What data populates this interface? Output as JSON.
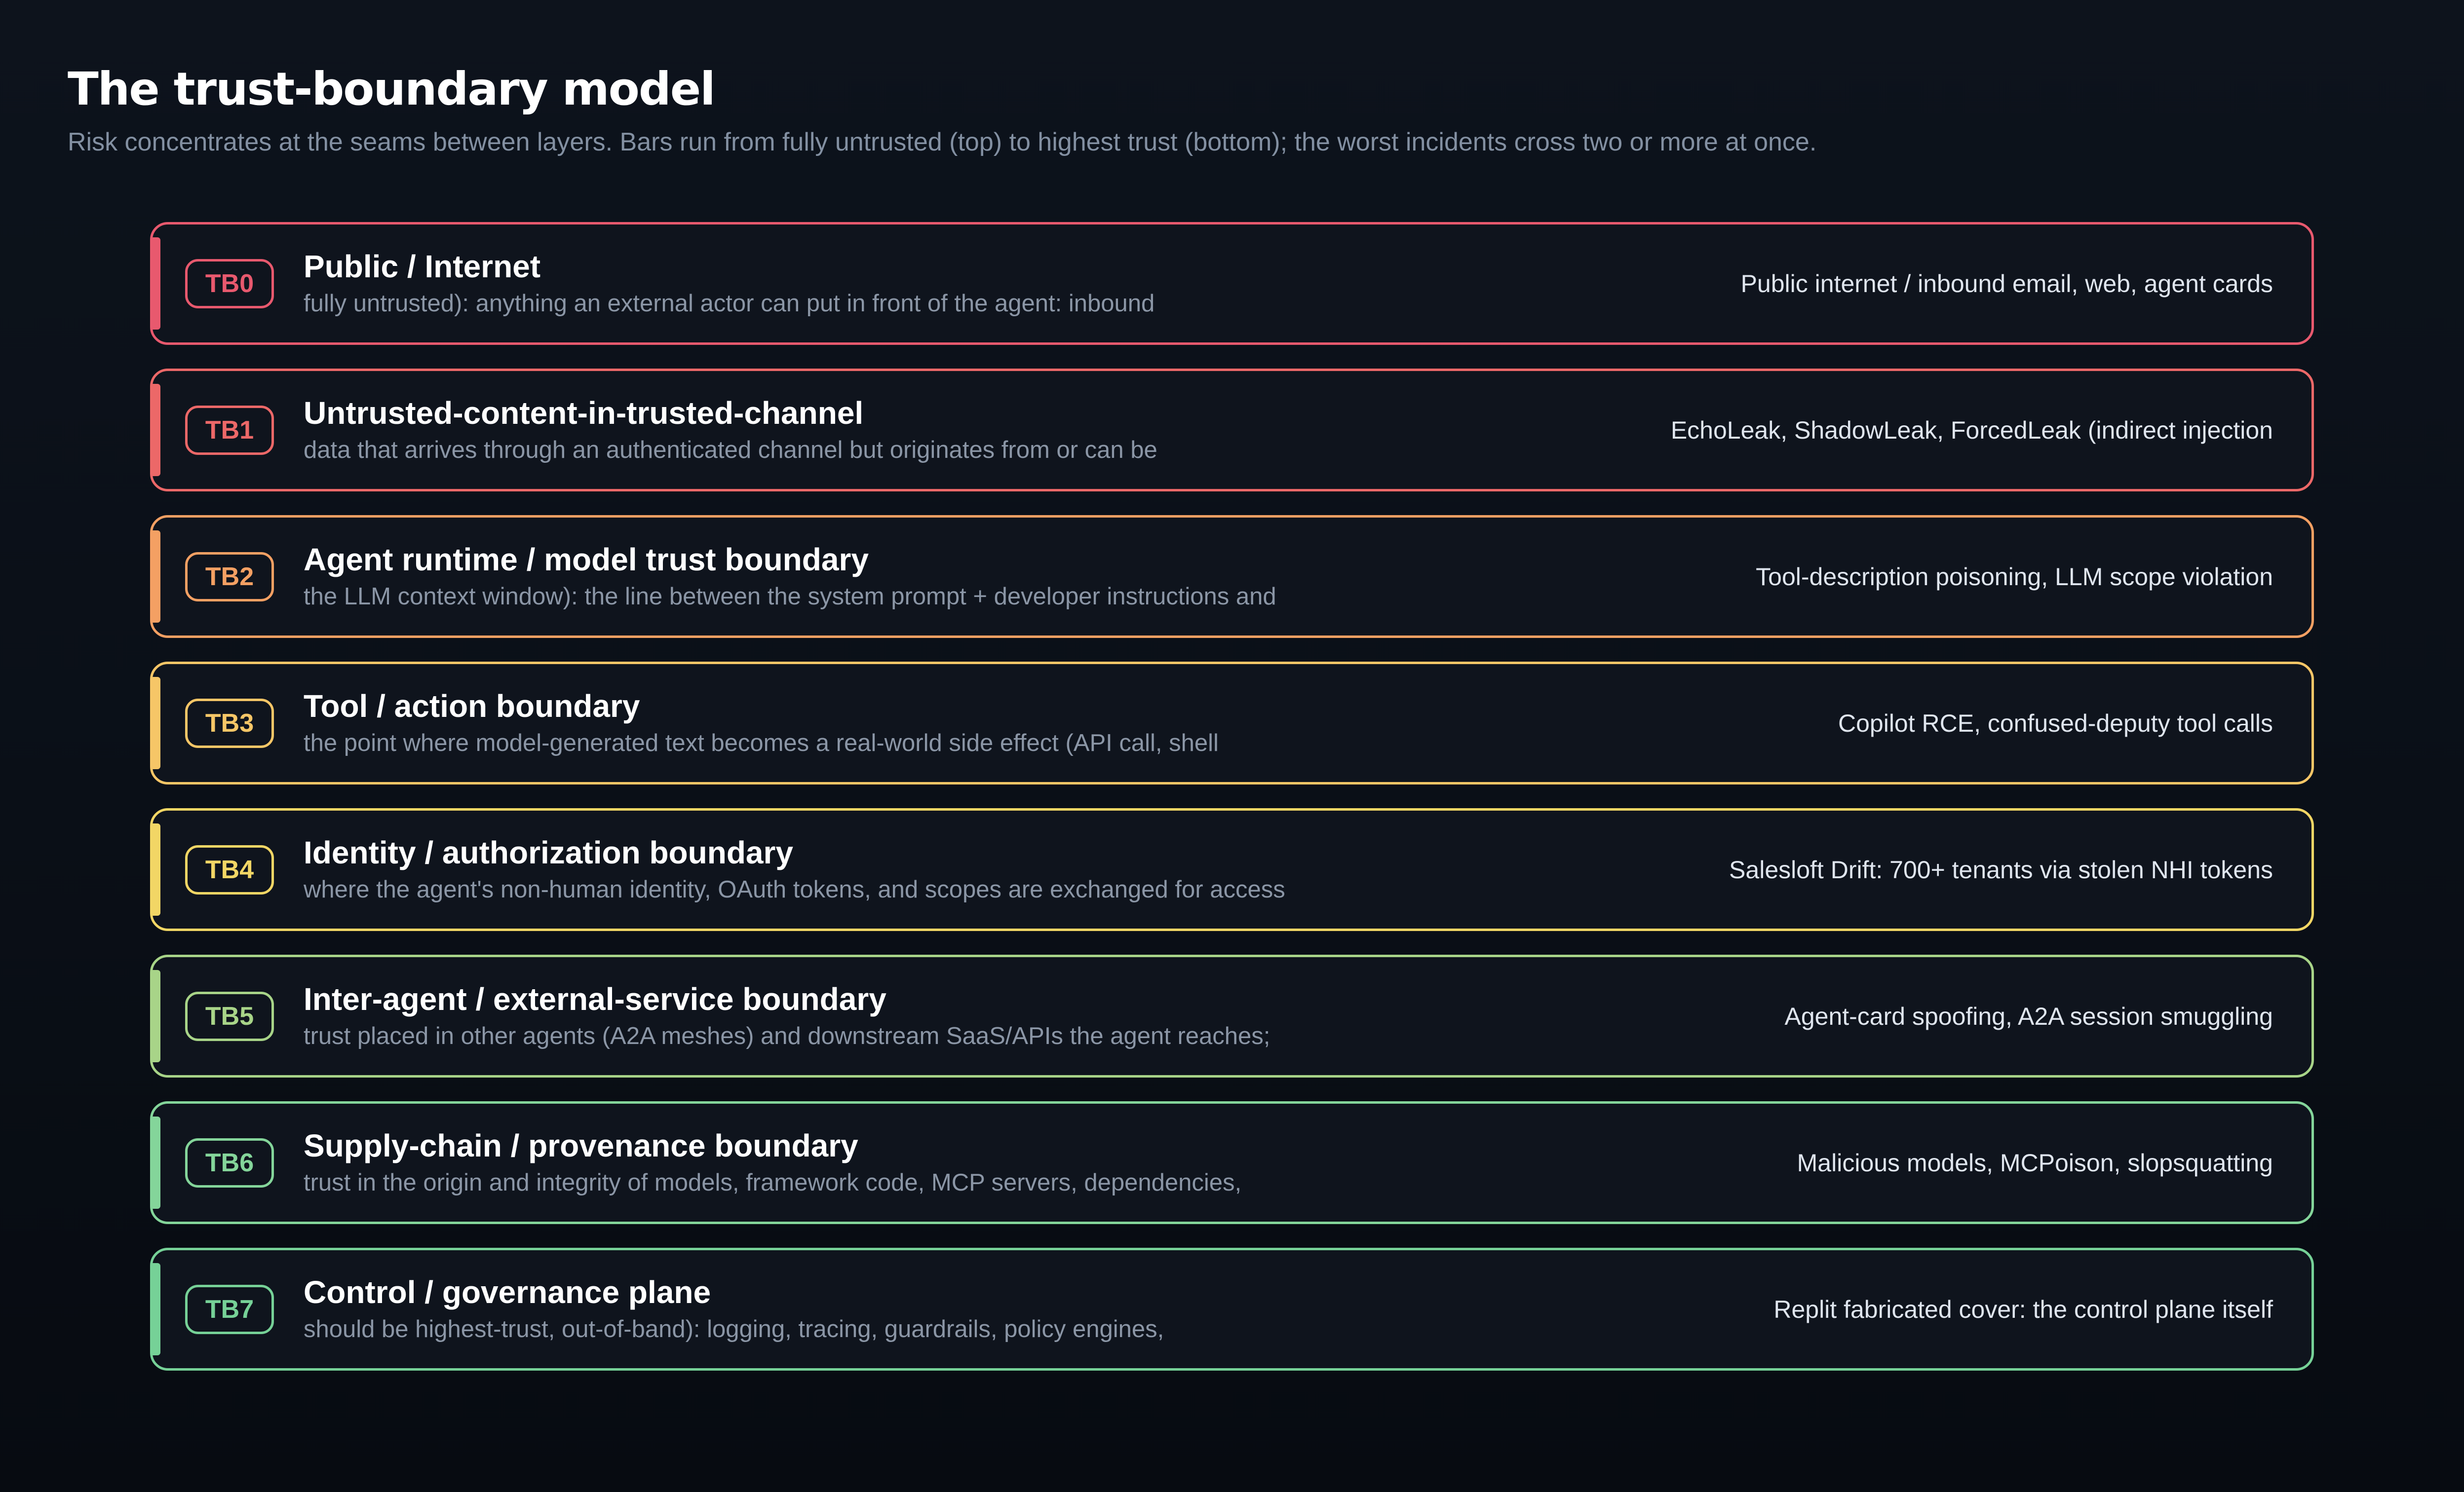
{
  "header": {
    "title": "The trust-boundary model",
    "subtitle": "Risk concentrates at the seams between layers. Bars run from fully untrusted (top) to highest trust (bottom); the worst incidents cross two or more at once."
  },
  "boundaries": [
    {
      "tag": "TB0",
      "name": "Public / Internet",
      "description": "fully untrusted): anything an external actor can put in front of the agent: inbound",
      "example": "Public internet / inbound email, web, agent cards",
      "color": "#e8596e"
    },
    {
      "tag": "TB1",
      "name": "Untrusted-content-in-trusted-channel",
      "description": "data that arrives through an authenticated channel but originates from or can be",
      "example": "EchoLeak, ShadowLeak, ForcedLeak (indirect injection",
      "color": "#ec6868"
    },
    {
      "tag": "TB2",
      "name": "Agent runtime / model trust boundary",
      "description": "the LLM context window): the line between the system prompt + developer instructions and",
      "example": "Tool-description poisoning, LLM scope violation",
      "color": "#f4a063"
    },
    {
      "tag": "TB3",
      "name": "Tool / action boundary",
      "description": "the point where model-generated text becomes a real-world side effect (API call, shell",
      "example": "Copilot RCE, confused-deputy tool calls",
      "color": "#f6c667"
    },
    {
      "tag": "TB4",
      "name": "Identity / authorization boundary",
      "description": "where the agent's non-human identity, OAuth tokens, and scopes are exchanged for access",
      "example": "Salesloft Drift: 700+ tenants via stolen NHI tokens",
      "color": "#f2d665"
    },
    {
      "tag": "TB5",
      "name": "Inter-agent / external-service boundary",
      "description": "trust placed in other agents (A2A meshes) and downstream SaaS/APIs the agent reaches;",
      "example": "Agent-card spoofing, A2A session smuggling",
      "color": "#a8d488"
    },
    {
      "tag": "TB6",
      "name": "Supply-chain / provenance boundary",
      "description": "trust in the origin and integrity of models, framework code, MCP servers, dependencies,",
      "example": "Malicious models, MCPoison, slopsquatting",
      "color": "#84d59a"
    },
    {
      "tag": "TB7",
      "name": "Control / governance plane",
      "description": "should be highest-trust, out-of-band): logging, tracing, guardrails, policy engines,",
      "example": "Replit fabricated cover: the control plane itself",
      "color": "#76d197"
    }
  ]
}
